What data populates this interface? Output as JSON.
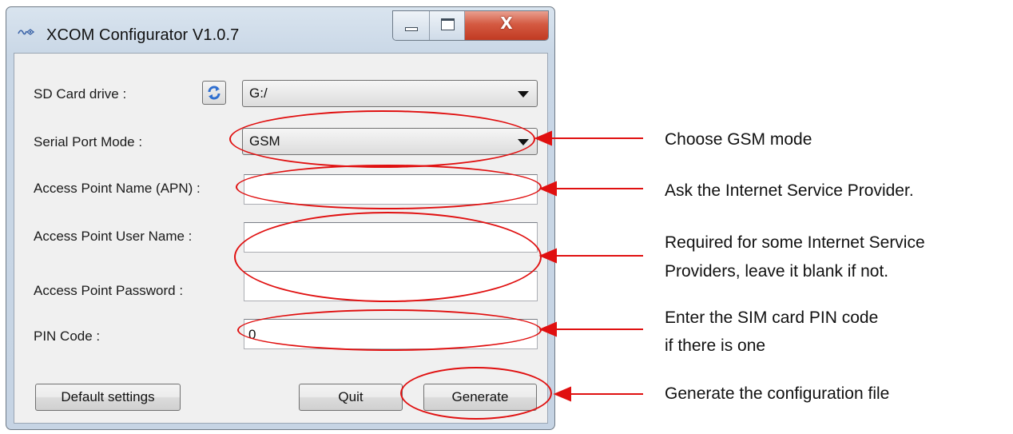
{
  "window": {
    "title": "XCOM Configurator V1.0.7",
    "close_glyph": "X"
  },
  "form": {
    "sd_card_drive": {
      "label": "SD Card drive :",
      "value": "G:/"
    },
    "serial_port_mode": {
      "label": "Serial Port Mode :",
      "value": "GSM"
    },
    "apn": {
      "label": "Access Point Name (APN) :",
      "value": ""
    },
    "user_name": {
      "label": "Access Point User Name :",
      "value": ""
    },
    "password": {
      "label": "Access Point Password :",
      "value": ""
    },
    "pin_code": {
      "label": "PIN Code :",
      "value": "0"
    }
  },
  "buttons": {
    "default_settings": "Default settings",
    "quit": "Quit",
    "generate": "Generate"
  },
  "annotations": {
    "gsm_mode": "Choose GSM mode",
    "apn": "Ask the Internet Service Provider.",
    "credentials_line1": "Required for some Internet Service",
    "credentials_line2": "Providers, leave it blank if not.",
    "pin_line1": "Enter the SIM card PIN code",
    "pin_line2": "if there is one",
    "generate": "Generate the configuration file"
  },
  "colors": {
    "annotation_red": "#e01010",
    "close_button": "#c13a22",
    "window_frame": "#c9d7e6"
  },
  "icons": [
    "app-icon",
    "refresh-icon",
    "dropdown-arrow-icon",
    "minimize-icon",
    "maximize-icon",
    "close-icon"
  ]
}
